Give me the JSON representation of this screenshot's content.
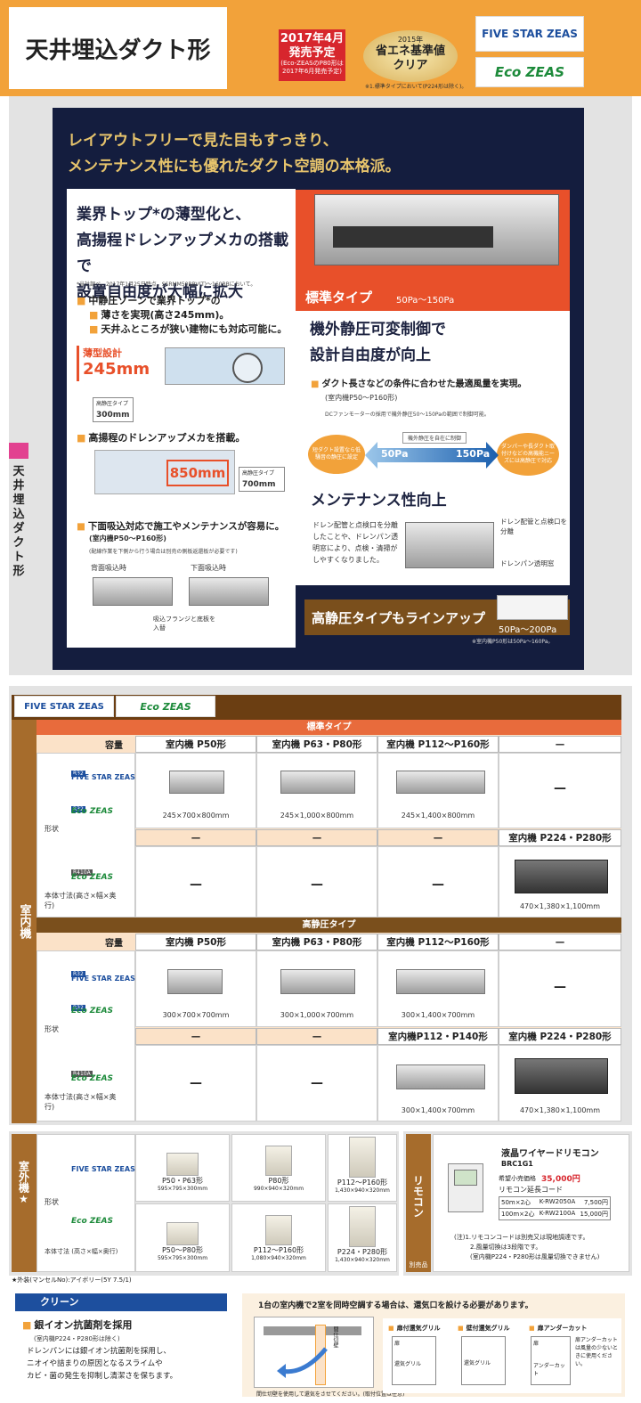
{
  "header": {
    "title": "天井埋込ダクト形",
    "release_l1": "2017年4月",
    "release_l2": "発売予定",
    "release_note": "(Eco-ZEASのP80形は2017年6月発売予定)",
    "std_year": "2015年",
    "std_l1": "省エネ基準値",
    "std_l2": "クリア",
    "std_note": "※1.標準タイプにおいて(P224形は除く)。",
    "logo_five": "FIVE STAR ZEAS",
    "logo_eco": "Eco ZEAS",
    "side_label": "天井埋込ダクト形"
  },
  "hero": {
    "lead1": "レイアウトフリーで見た目もすっきり、",
    "lead2": "メンテナンス性にも優れたダクト空調の本格派。",
    "h_l1": "業界トップ*の薄型化と、",
    "h_l2": "高揚程ドレンアップメカの搭載で",
    "h_l3": "設置自由度が大幅に拡大",
    "h_note": "*当社調べ。2017年1月25日時点。SSRMM50BBV(T)〜160BBにおいて。",
    "b1_l1": "中静圧ゾーンで業界トップ*の",
    "b1_l2": "薄さを実現(高さ245mm)。",
    "b1_l3": "天井ふところが狭い建物にも対応可能に。",
    "thin_label": "薄型設計",
    "thin_val": "245mm",
    "hp_label": "高静圧タイプ",
    "hp_val": "300mm",
    "b2": "高揚程のドレンアップメカを搭載。",
    "drain_val": "850mm",
    "hp2_label": "高静圧タイプ",
    "hp2_val": "700mm",
    "b3": "下面吸込対応で施工やメンテナンスが容易に。",
    "b3_sub": "(室内機P50〜P160形)",
    "b3_note": "(配線作業を下側から行う場合は別売の側板返還板が必要です)",
    "back_label": "背面吸込時",
    "bottom_label": "下面吸込時",
    "flange": "吸込フランジと底板を入替",
    "std_type": "標準タイプ",
    "std_range": "50Pa〜150Pa",
    "r_h1": "機外静圧可変制御で",
    "r_h2": "設計自由度が向上",
    "rb1": "ダクト長さなどの条件に合わせた最適風量を実現。",
    "rb1_sub": "(室内機P50〜P160形)",
    "rb1_note": "DCファンモーターの採用で機外静圧50〜150Paの範囲で制御可能。",
    "ctrl_label": "機外静圧を自在に制御",
    "pa_low": "50Pa",
    "pa_high": "150Pa",
    "left_circle": "短ダクト設置なら低騒音の静圧に設定",
    "right_circle": "ダンパーや長ダクト取付けなどの高機能ニーズには高静圧で対応",
    "maint_h": "メンテナンス性向上",
    "maint_text": "ドレン配管と点検口を分離したことや、ドレンパン透明窓により、点検・清掃がしやすくなりました。",
    "maint_c1": "ドレン配管と点検口を分離",
    "maint_c2": "ドレンパン透明窓",
    "lineup": "高静圧タイプもラインアップ",
    "lineup_range": "50Pa〜200Pa",
    "lineup_note": "※室内機P50形は50Pa〜160Pa。"
  },
  "table": {
    "logo_five": "FIVE STAR ZEAS",
    "logo_eco": "Eco ZEAS",
    "indoor_label": "室内機",
    "std_band": "標準タイプ",
    "hp_band": "高静圧タイプ",
    "cap_label": "容量",
    "shape_label": "形状",
    "dim_label": "本体寸法(高さ×幅×奥行)",
    "r32": "R32",
    "r410a": "R410A",
    "std_heads": [
      "室内機 P50形",
      "室内機 P63・P80形",
      "室内機 P112〜P160形",
      "—"
    ],
    "std_dims": [
      "245×700×800mm",
      "245×1,000×800mm",
      "245×1,400×800mm"
    ],
    "std_sub": [
      "—",
      "—",
      "—",
      "室内機 P224・P280形"
    ],
    "std_big": "470×1,380×1,100mm",
    "hp_heads": [
      "室内機 P50形",
      "室内機 P63・P80形",
      "室内機 P112〜P160形",
      "—"
    ],
    "hp_dims": [
      "300×700×700mm",
      "300×1,000×700mm",
      "300×1,400×700mm"
    ],
    "hp_sub": [
      "—",
      "—",
      "室内機P112・P140形",
      "室内機 P224・P280形"
    ],
    "hp_sub_dim": "300×1,400×700mm",
    "hp_big": "470×1,380×1,100mm",
    "dash": "—"
  },
  "outdoor": {
    "label": "室外機★",
    "shape": "形状",
    "dim": "本体寸法 (高さ×幅×奥行)",
    "five": [
      {
        "n": "P50・P63形",
        "d": "595×795×300mm"
      },
      {
        "n": "P80形",
        "d": "990×940×320mm"
      },
      {
        "n": "P112〜P160形",
        "d": "1,430×940×320mm"
      }
    ],
    "eco": [
      {
        "n": "P50〜P80形",
        "d": "595×795×300mm"
      },
      {
        "n": "P112〜P160形",
        "d": "1,080×940×320mm"
      },
      {
        "n": "P224・P280形",
        "d": "1,430×940×320mm"
      }
    ],
    "foot": "★外装(マンセルNo):アイボリー(5Y 7.5/1)"
  },
  "remote": {
    "label": "リモコン",
    "title": "液晶ワイヤードリモコン",
    "model": "BRC1G1",
    "price_label": "希望小売価格",
    "price": "35,000円",
    "ext": "リモコン延長コード",
    "rows": [
      [
        "50m×2心",
        "K-RW2050A",
        "7,500円"
      ],
      [
        "100m×2心",
        "K-RW2100A",
        "15,000円"
      ]
    ],
    "n1": "(注)1.リモコンコードは別売又は現地調達です。",
    "n2": "2.風量切換は3段階です。",
    "n3": "(室内機P224・P280形は風量切換できません)",
    "sep": "別売品"
  },
  "clean": {
    "head": "クリーン",
    "title": "銀イオン抗菌剤を採用",
    "sub": "(室内機P224・P280形は除く)",
    "t1": "ドレンパンには銀イオン抗菌剤を採用し、",
    "t2": "ニオイや詰まりの原因となるスライムや",
    "t3": "カビ・菌の発生を抑制し清潔さを保ちます。"
  },
  "tworoom": {
    "title": "1台の室内機で2室を同時空調する場合は、還気口を設ける必要があります。",
    "c1": "扉付還気グリル",
    "c2": "壁付還気グリル",
    "c3": "扉アンダーカット",
    "door": "扉",
    "grille": "還気グリル",
    "undercut": "アンダーカット",
    "uc_note": "扉アンダーカットは風量の少ないときに使用ください。",
    "note": "間仕切壁を使用して還気をさせてください。(取付位置は任意)",
    "label_partition": "間仕切壁"
  }
}
